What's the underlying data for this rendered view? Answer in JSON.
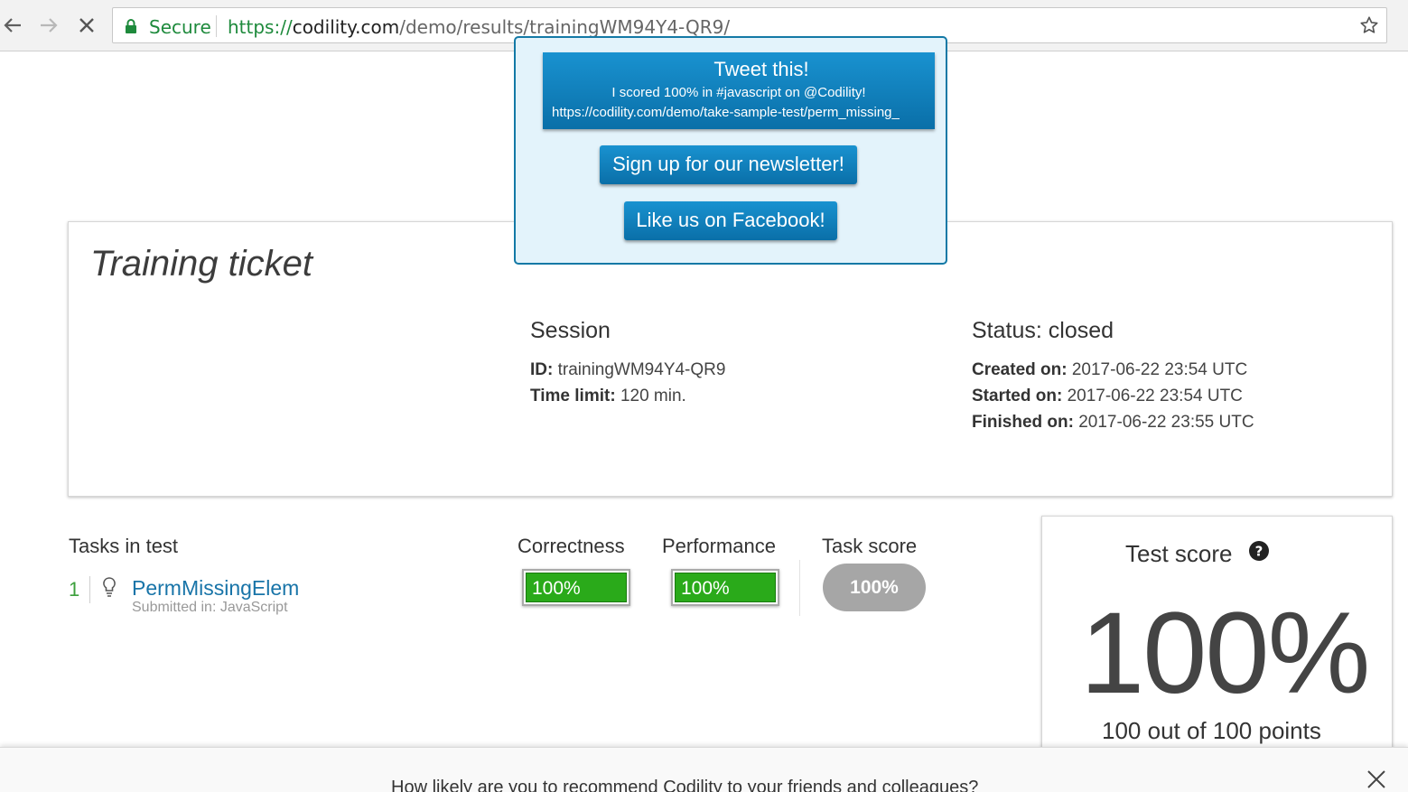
{
  "browser": {
    "secure_label": "Secure",
    "url_scheme": "https://",
    "url_host": "codility.com",
    "url_path": "/demo/results/trainingWM94Y4-QR9/"
  },
  "share": {
    "tweet_title": "Tweet this!",
    "tweet_text": "I scored 100% in #javascript on @Codility!",
    "tweet_link": "https://codility.com/demo/take-sample-test/perm_missing_",
    "newsletter_label": "Sign up for our newsletter!",
    "facebook_label": "Like us on Facebook!"
  },
  "ticket": {
    "title": "Training ticket",
    "session_heading": "Session",
    "id_label": "ID:",
    "id_value": "trainingWM94Y4-QR9",
    "time_limit_label": "Time limit:",
    "time_limit_value": "120 min.",
    "status_heading": "Status: closed",
    "created_label": "Created on:",
    "created_value": "2017-06-22 23:54 UTC",
    "started_label": "Started on:",
    "started_value": "2017-06-22 23:54 UTC",
    "finished_label": "Finished on:",
    "finished_value": "2017-06-22 23:55 UTC"
  },
  "tasks": {
    "heading": "Tasks in test",
    "columns": {
      "correctness": "Correctness",
      "performance": "Performance",
      "task_score": "Task score"
    },
    "items": [
      {
        "number": "1",
        "name": "PermMissingElem",
        "submitted": "Submitted in: JavaScript",
        "correctness": "100%",
        "performance": "100%",
        "score": "100%"
      }
    ]
  },
  "test_score": {
    "title": "Test score",
    "value": "100%",
    "points": "100 out of 100 points"
  },
  "survey": {
    "question": "How likely are you to recommend Codility to your friends and colleagues?"
  },
  "colors": {
    "brand_blue": "#0a6fa8",
    "success_green": "#2aaa1a",
    "secure_green": "#1e8a3c",
    "neutral_pill": "#a6a6a6"
  }
}
